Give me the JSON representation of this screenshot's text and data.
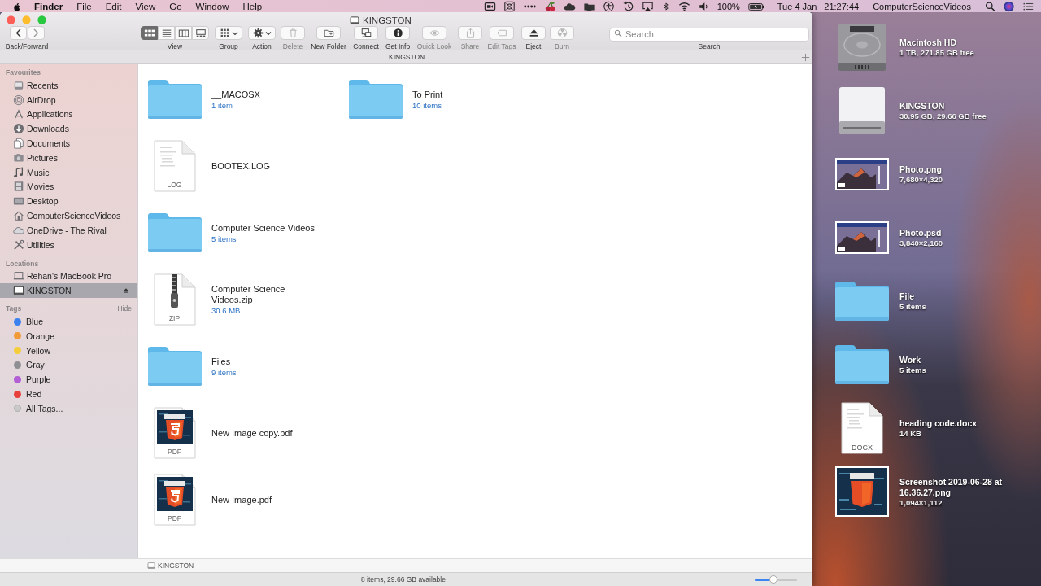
{
  "menu_bar": {
    "menus": [
      {
        "label": "Finder",
        "kind": "app"
      },
      {
        "label": "File",
        "kind": "menu"
      },
      {
        "label": "Edit",
        "kind": "menu"
      },
      {
        "label": "View",
        "kind": "menu"
      },
      {
        "label": "Go",
        "kind": "menu"
      },
      {
        "label": "Window",
        "kind": "menu"
      },
      {
        "label": "Help",
        "kind": "menu"
      }
    ],
    "battery": "100%",
    "date": "Tue 4 Jan",
    "time": "21:27:44",
    "user": "ComputerScienceVideos"
  },
  "window": {
    "title": "KINGSTON",
    "toolbar": {
      "nav_label": "Back/Forward",
      "view_label": "View",
      "view_modes": [
        {
          "selected": true
        },
        {
          "selected": false
        },
        {
          "selected": false
        },
        {
          "selected": false
        }
      ],
      "tools": [
        {
          "kind": "group",
          "label": "Group",
          "disabled": false
        },
        {
          "kind": "action",
          "label": "Action",
          "disabled": false
        },
        {
          "kind": "delete",
          "label": "Delete",
          "disabled": true
        },
        {
          "kind": "new-folder",
          "label": "New Folder",
          "disabled": false
        },
        {
          "kind": "connect",
          "label": "Connect",
          "disabled": false
        },
        {
          "kind": "info",
          "label": "Get Info",
          "disabled": false
        },
        {
          "kind": "quick-look",
          "label": "Quick Look",
          "disabled": true
        },
        {
          "kind": "share",
          "label": "Share",
          "disabled": true
        },
        {
          "kind": "tags",
          "label": "Edit Tags",
          "disabled": true
        },
        {
          "kind": "eject",
          "label": "Eject",
          "disabled": false
        },
        {
          "kind": "burn",
          "label": "Burn",
          "disabled": true
        }
      ],
      "search": {
        "placeholder": "Search",
        "label": "Search"
      }
    },
    "path_header": "KINGSTON",
    "sidebar": {
      "sections": [
        {
          "title": "Favourites",
          "items": [
            {
              "label": "Recents",
              "kind": "recents",
              "selected": false
            },
            {
              "label": "AirDrop",
              "kind": "airdrop",
              "selected": false
            },
            {
              "label": "Applications",
              "kind": "applications",
              "selected": false
            },
            {
              "label": "Downloads",
              "kind": "downloads",
              "selected": false
            },
            {
              "label": "Documents",
              "kind": "documents",
              "selected": false
            },
            {
              "label": "Pictures",
              "kind": "pictures",
              "selected": false
            },
            {
              "label": "Music",
              "kind": "music",
              "selected": false
            },
            {
              "label": "Movies",
              "kind": "movies",
              "selected": false
            },
            {
              "label": "Desktop",
              "kind": "desktop",
              "selected": false
            },
            {
              "label": "ComputerScienceVideos",
              "kind": "home",
              "selected": false
            },
            {
              "label": "OneDrive - The Rival",
              "kind": "cloud",
              "selected": false
            },
            {
              "label": "Utilities",
              "kind": "utilities",
              "selected": false
            }
          ]
        },
        {
          "title": "Locations",
          "items": [
            {
              "label": "Rehan's MacBook Pro",
              "kind": "laptop",
              "selected": false,
              "ejectable": false
            },
            {
              "label": "KINGSTON",
              "kind": "drive",
              "selected": true,
              "ejectable": true
            }
          ]
        },
        {
          "title": "Tags",
          "action": "Hide",
          "items": [
            {
              "label": "Blue",
              "kind": "tag",
              "color": "#3b82f0",
              "selected": false
            },
            {
              "label": "Orange",
              "kind": "tag",
              "color": "#f39a38",
              "selected": false
            },
            {
              "label": "Yellow",
              "kind": "tag",
              "color": "#f5cd3b",
              "selected": false
            },
            {
              "label": "Gray",
              "kind": "tag",
              "color": "#8e8e93",
              "selected": false
            },
            {
              "label": "Purple",
              "kind": "tag",
              "color": "#b25fd6",
              "selected": false
            },
            {
              "label": "Red",
              "kind": "tag",
              "color": "#e8413c",
              "selected": false
            },
            {
              "label": "All Tags...",
              "kind": "all-tags",
              "selected": false
            }
          ]
        }
      ]
    },
    "files": [
      {
        "name": "__MACOSX",
        "detail": "1 item",
        "kind": "folder"
      },
      {
        "name": "BOOTEX.LOG",
        "kind": "document",
        "badge": "LOG"
      },
      {
        "name": "Computer Science Videos",
        "detail": "5 items",
        "kind": "folder"
      },
      {
        "name": "Computer Science Videos.zip",
        "detail": "30.6 MB",
        "kind": "archive",
        "badge": "ZIP"
      },
      {
        "name": "Files",
        "detail": "9 items",
        "kind": "folder"
      },
      {
        "name": "New Image copy.pdf",
        "kind": "pdf",
        "badge": "PDF"
      },
      {
        "name": "New Image.pdf",
        "kind": "pdf",
        "badge": "PDF"
      },
      {
        "name": "To Print",
        "detail": "10 items",
        "kind": "folder"
      }
    ],
    "path_bar": "KINGSTON",
    "status": "8 items, 29.66 GB available",
    "icon_size": {
      "level": 0.45
    }
  },
  "desktop": {
    "icons": [
      {
        "name": "Macintosh HD",
        "detail": "1 TB, 271.85 GB free",
        "kind": "drive"
      },
      {
        "name": "KINGSTON",
        "detail": "30.95 GB, 29.66 GB free",
        "kind": "external-drive"
      },
      {
        "name": "Photo.png",
        "detail": "7,680×4,320"
      },
      {
        "name": "Photo.psd",
        "detail": "3,840×2,160"
      },
      {
        "name": "File",
        "detail": "5 items",
        "kind": "folder"
      },
      {
        "name": "Work",
        "detail": "5 items",
        "kind": "folder"
      },
      {
        "name": "heading code.docx",
        "detail": "14 KB",
        "kind": "document",
        "badge": "DOCX"
      },
      {
        "name": "Screenshot 2019-06-28 at 16.36.27.png",
        "detail": "1,094×1,112",
        "kind": "code-image"
      }
    ]
  }
}
